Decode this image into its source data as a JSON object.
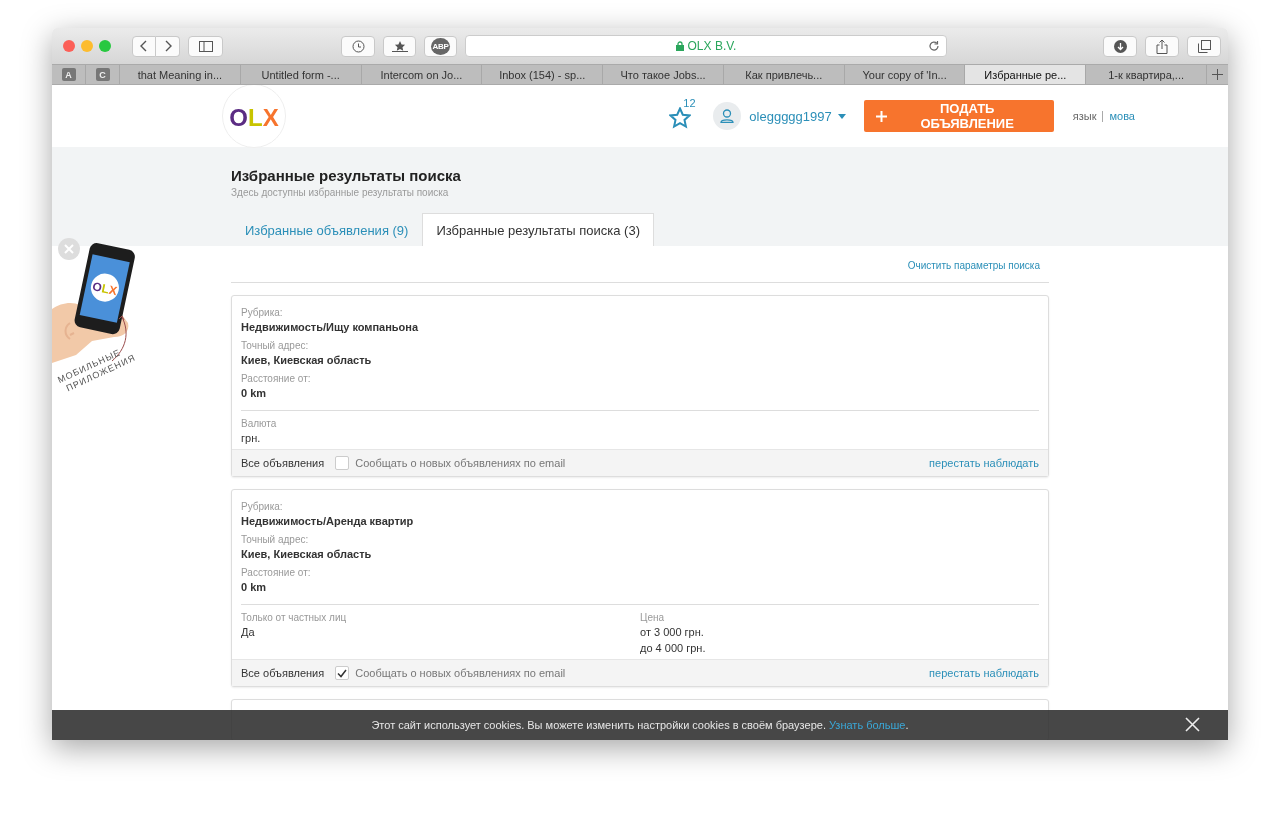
{
  "browser": {
    "url": "OLX B.V.",
    "adblock": "ABP",
    "pinned_tabs": [
      "A",
      "C"
    ],
    "tabs": [
      {
        "label": "that Meaning in...",
        "selected": false
      },
      {
        "label": "Untitled form -...",
        "selected": false
      },
      {
        "label": "Intercom on Jo...",
        "selected": false
      },
      {
        "label": "Inbox (154) - sp...",
        "selected": false
      },
      {
        "label": "Что такое Jobs...",
        "selected": false
      },
      {
        "label": "Как привлечь...",
        "selected": false
      },
      {
        "label": "Your copy of 'In...",
        "selected": false
      },
      {
        "label": "Избранные ре...",
        "selected": true
      },
      {
        "label": "1-к квартира,...",
        "selected": false
      }
    ]
  },
  "header": {
    "logo": "OLX",
    "favorites_count": "12",
    "username": "oleggggg1997",
    "post_button": "ПОДАТЬ ОБЪЯВЛЕНИЕ",
    "languages": [
      {
        "label": "язык",
        "selected": true
      },
      {
        "label": "мова",
        "selected": false
      }
    ]
  },
  "page": {
    "title": "Избранные результаты поиска",
    "subtitle": "Здесь доступны избранные результаты поиска",
    "tabs": [
      {
        "label": "Избранные объявления (9)",
        "selected": false
      },
      {
        "label": "Избранные результаты поиска (3)",
        "selected": true
      }
    ],
    "clear_link": "Очистить параметры поиска"
  },
  "cards": [
    {
      "kind": "full",
      "fields": [
        {
          "label": "Рубрика:",
          "value": "Недвижимость/Ищу компаньона"
        },
        {
          "label": "Точный адрес:",
          "value": "Киев, Киевская область"
        },
        {
          "label": "Расстояние от:",
          "value": "0 km"
        }
      ],
      "extra_fields": [
        {
          "label": "Валюта",
          "lines": [
            "грн."
          ]
        }
      ],
      "footer": {
        "all_link": "Все объявления",
        "notify": {
          "label": "Сообщать о новых объявлениях по email",
          "checked": false
        },
        "stop_link": "перестать наблюдать"
      }
    },
    {
      "kind": "full",
      "fields": [
        {
          "label": "Рубрика:",
          "value": "Недвижимость/Аренда квартир"
        },
        {
          "label": "Точный адрес:",
          "value": "Киев, Киевская область"
        },
        {
          "label": "Расстояние от:",
          "value": "0 km"
        }
      ],
      "extra_fields": [
        {
          "label": "Только от частных лиц",
          "lines": [
            "Да"
          ]
        },
        {
          "label": "Цена",
          "lines": [
            "от 3 000 грн.",
            "до 4 000 грн."
          ]
        }
      ],
      "footer": {
        "all_link": "Все объявления",
        "notify": {
          "label": "Сообщать о новых объявлениях по email",
          "checked": true
        },
        "stop_link": "перестать наблюдать"
      }
    },
    {
      "kind": "cut"
    }
  ],
  "promo": {
    "logo": "OLX",
    "caption": [
      "МОБИЛЬНЫЕ",
      "ПРИЛОЖЕНИЯ"
    ]
  },
  "cookie_bar": {
    "text": "Этот сайт использует cookies. Вы можете изменить настройки cookies в своём браузере. ",
    "link": "Узнать больше",
    "tail": "."
  }
}
